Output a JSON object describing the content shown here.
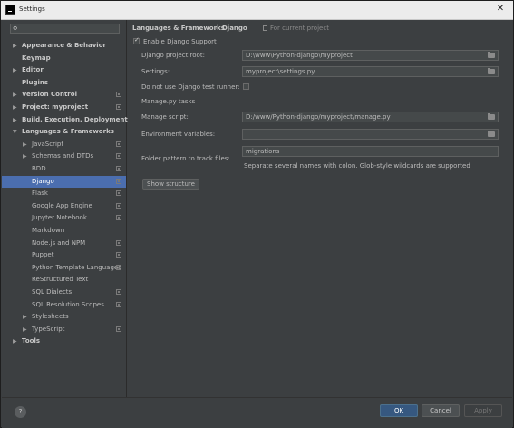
{
  "window": {
    "title": "Settings",
    "close": "✕"
  },
  "search": {
    "placeholder": ""
  },
  "tree": [
    {
      "label": "Appearance & Behavior",
      "level": 0,
      "bold": true,
      "arrow": "right",
      "cfg": false
    },
    {
      "label": "Keymap",
      "level": 0,
      "bold": true,
      "arrow": "",
      "cfg": false
    },
    {
      "label": "Editor",
      "level": 0,
      "bold": true,
      "arrow": "right",
      "cfg": false
    },
    {
      "label": "Plugins",
      "level": 0,
      "bold": true,
      "arrow": "",
      "cfg": false
    },
    {
      "label": "Version Control",
      "level": 0,
      "bold": true,
      "arrow": "right",
      "cfg": true
    },
    {
      "label": "Project: myproject",
      "level": 0,
      "bold": true,
      "arrow": "right",
      "cfg": true
    },
    {
      "label": "Build, Execution, Deployment",
      "level": 0,
      "bold": true,
      "arrow": "right",
      "cfg": false
    },
    {
      "label": "Languages & Frameworks",
      "level": 0,
      "bold": true,
      "arrow": "down",
      "cfg": false
    },
    {
      "label": "JavaScript",
      "level": 1,
      "bold": false,
      "arrow": "right",
      "cfg": true
    },
    {
      "label": "Schemas and DTDs",
      "level": 1,
      "bold": false,
      "arrow": "right",
      "cfg": true
    },
    {
      "label": "BDD",
      "level": 1,
      "bold": false,
      "arrow": "",
      "cfg": true
    },
    {
      "label": "Django",
      "level": 1,
      "bold": false,
      "arrow": "",
      "cfg": true,
      "selected": true
    },
    {
      "label": "Flask",
      "level": 1,
      "bold": false,
      "arrow": "",
      "cfg": true
    },
    {
      "label": "Google App Engine",
      "level": 1,
      "bold": false,
      "arrow": "",
      "cfg": true
    },
    {
      "label": "Jupyter Notebook",
      "level": 1,
      "bold": false,
      "arrow": "",
      "cfg": true
    },
    {
      "label": "Markdown",
      "level": 1,
      "bold": false,
      "arrow": "",
      "cfg": false
    },
    {
      "label": "Node.js and NPM",
      "level": 1,
      "bold": false,
      "arrow": "",
      "cfg": true
    },
    {
      "label": "Puppet",
      "level": 1,
      "bold": false,
      "arrow": "",
      "cfg": true
    },
    {
      "label": "Python Template Languages",
      "level": 1,
      "bold": false,
      "arrow": "",
      "cfg": true
    },
    {
      "label": "ReStructured Text",
      "level": 1,
      "bold": false,
      "arrow": "",
      "cfg": false
    },
    {
      "label": "SQL Dialects",
      "level": 1,
      "bold": false,
      "arrow": "",
      "cfg": true
    },
    {
      "label": "SQL Resolution Scopes",
      "level": 1,
      "bold": false,
      "arrow": "",
      "cfg": true
    },
    {
      "label": "Stylesheets",
      "level": 1,
      "bold": false,
      "arrow": "right",
      "cfg": false
    },
    {
      "label": "TypeScript",
      "level": 1,
      "bold": false,
      "arrow": "right",
      "cfg": true
    },
    {
      "label": "Tools",
      "level": 0,
      "bold": true,
      "arrow": "right",
      "cfg": false
    }
  ],
  "breadcrumb": {
    "part1": "Languages & Frameworks",
    "sep": "›",
    "part2": "Django",
    "scope": "For current project"
  },
  "form": {
    "enable_label": "Enable Django Support",
    "enable_checked": true,
    "root_label": "Django project root:",
    "root_value": "D:\\www\\Python-django\\myproject",
    "settings_label": "Settings:",
    "settings_value": "myproject\\settings.py",
    "test_runner_label": "Do not use Django test runner:",
    "test_runner_checked": false,
    "manage_section": "Manage.py tasks",
    "manage_label": "Manage script:",
    "manage_value": "D:/www/Python-django/myproject/manage.py",
    "env_label": "Environment variables:",
    "env_value": "",
    "folder_label": "Folder pattern to track files:",
    "folder_value": "migrations",
    "folder_hint": "Separate several names with colon. Glob-style wildcards are supported",
    "show_structure": "Show structure"
  },
  "footer": {
    "help": "?",
    "ok": "OK",
    "cancel": "Cancel",
    "apply": "Apply"
  }
}
